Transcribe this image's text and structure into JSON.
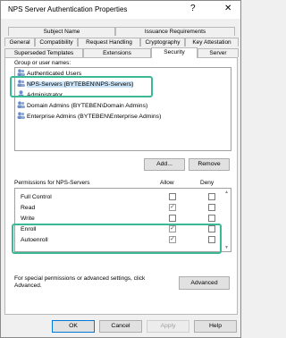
{
  "window": {
    "title": "NPS Server Authentication Properties",
    "help_glyph": "?",
    "close_glyph": "✕"
  },
  "tabs": {
    "row1": [
      "Subject Name",
      "Issuance Requirements"
    ],
    "row2": [
      "General",
      "Compatibility",
      "Request Handling",
      "Cryptography",
      "Key Attestation"
    ],
    "row3": [
      "Superseded Templates",
      "Extensions",
      "Security",
      "Server"
    ],
    "active": "Security"
  },
  "groups": {
    "label": "Group or user names:",
    "items": [
      {
        "name": "Authenticated Users",
        "selected": false
      },
      {
        "name": "NPS-Servers (BYTEBEN\\NPS-Servers)",
        "selected": true
      },
      {
        "name": "Administrator",
        "selected": false
      },
      {
        "name": "Domain Admins (BYTEBEN\\Domain Admins)",
        "selected": false
      },
      {
        "name": "Enterprise Admins (BYTEBEN\\Enterprise Admins)",
        "selected": false
      }
    ]
  },
  "buttons": {
    "add": "Add...",
    "remove": "Remove",
    "advanced": "Advanced",
    "ok": "OK",
    "cancel": "Cancel",
    "apply": "Apply",
    "help": "Help"
  },
  "permissions": {
    "label": "Permissions for NPS-Servers",
    "allow_header": "Allow",
    "deny_header": "Deny",
    "rows": [
      {
        "name": "Full Control",
        "allow": false,
        "deny": false
      },
      {
        "name": "Read",
        "allow": true,
        "deny": false
      },
      {
        "name": "Write",
        "allow": false,
        "deny": false
      },
      {
        "name": "Enroll",
        "allow": true,
        "deny": false
      },
      {
        "name": "Autoenroll",
        "allow": true,
        "deny": false
      }
    ]
  },
  "special_text": "For special permissions or advanced settings, click Advanced.",
  "colors": {
    "highlight": "#3bb894",
    "selection": "#cce4f7",
    "default_button_border": "#0078d7"
  }
}
